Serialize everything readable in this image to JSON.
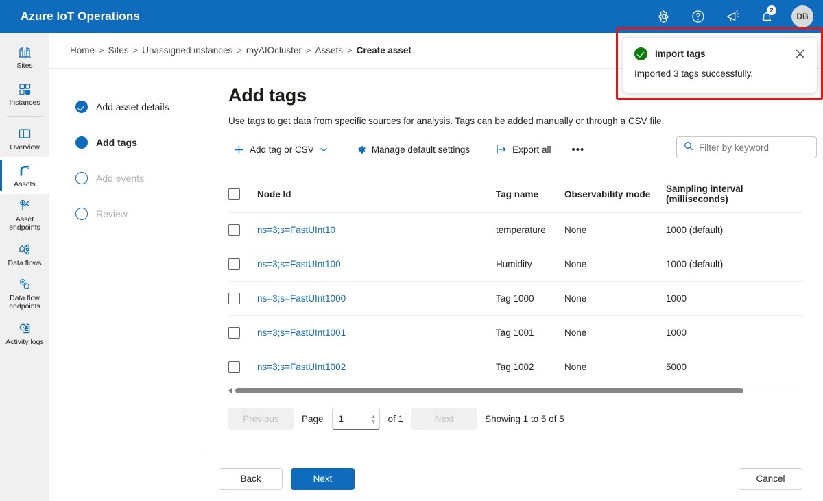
{
  "header": {
    "title": "Azure IoT Operations",
    "icons": [
      {
        "name": "gear-icon",
        "label": "Settings"
      },
      {
        "name": "help-icon",
        "label": "Help"
      },
      {
        "name": "megaphone-icon",
        "label": "Announcements"
      },
      {
        "name": "bell-icon",
        "label": "Notifications",
        "badge": "2"
      }
    ],
    "avatar": "DB",
    "brand_color": "#0f6cbd"
  },
  "sidebar": {
    "items": [
      {
        "label": "Sites",
        "icon": "sites-icon",
        "selected": false
      },
      {
        "label": "Instances",
        "icon": "instances-icon",
        "selected": false
      },
      {
        "label": "Overview",
        "icon": "overview-icon",
        "selected": false
      },
      {
        "label": "Assets",
        "icon": "assets-icon",
        "selected": true
      },
      {
        "label": "Asset endpoints",
        "icon": "asset-endpoints-icon",
        "selected": false
      },
      {
        "label": "Data flows",
        "icon": "data-flows-icon",
        "selected": false
      },
      {
        "label": "Data flow endpoints",
        "icon": "data-flow-endpoints-icon",
        "selected": false
      },
      {
        "label": "Activity logs",
        "icon": "activity-logs-icon",
        "selected": false
      }
    ]
  },
  "breadcrumb": {
    "separator": ">",
    "items": [
      {
        "label": "Home",
        "current": false
      },
      {
        "label": "Sites",
        "current": false
      },
      {
        "label": "Unassigned instances",
        "current": false
      },
      {
        "label": "myAIOcluster",
        "current": false
      },
      {
        "label": "Assets",
        "current": false
      },
      {
        "label": "Create asset",
        "current": true
      }
    ]
  },
  "wizard": {
    "steps": [
      {
        "label": "Add asset details",
        "state": "done"
      },
      {
        "label": "Add tags",
        "state": "active"
      },
      {
        "label": "Add events",
        "state": "todo"
      },
      {
        "label": "Review",
        "state": "todo"
      }
    ]
  },
  "main": {
    "title": "Add tags",
    "description": "Use tags to get data from specific sources for analysis. Tags can be added manually or through a CSV file.",
    "toolbar": {
      "add_tag_label": "Add tag or CSV",
      "add_tag_chevron": "⌄",
      "manage_defaults_label": "Manage default settings",
      "export_all_label": "Export all",
      "overflow_label": "•••"
    },
    "search": {
      "placeholder": "Filter by keyword",
      "value": ""
    },
    "table": {
      "columns": [
        "Node Id",
        "Tag name",
        "Observability mode",
        "Sampling interval (milliseconds)"
      ],
      "rows": [
        {
          "node_id": "ns=3;s=FastUInt10",
          "tag_name": "temperature",
          "observability": "None",
          "sampling": "1000 (default)"
        },
        {
          "node_id": "ns=3;s=FastUInt100",
          "tag_name": "Humidity",
          "observability": "None",
          "sampling": "1000 (default)"
        },
        {
          "node_id": "ns=3;s=FastUInt1000",
          "tag_name": "Tag 1000",
          "observability": "None",
          "sampling": "1000"
        },
        {
          "node_id": "ns=3;s=FastUInt1001",
          "tag_name": "Tag 1001",
          "observability": "None",
          "sampling": "1000"
        },
        {
          "node_id": "ns=3;s=FastUInt1002",
          "tag_name": "Tag 1002",
          "observability": "None",
          "sampling": "5000"
        }
      ]
    },
    "pagination": {
      "previous_label": "Previous",
      "page_label": "Page",
      "page_value": "1",
      "of_label": "of 1",
      "next_label": "Next",
      "showing_label": "Showing 1 to 5 of 5"
    }
  },
  "footer": {
    "back_label": "Back",
    "next_label": "Next",
    "cancel_label": "Cancel"
  },
  "toast": {
    "title": "Import tags",
    "message": "Imported 3 tags successfully.",
    "status": "success",
    "status_color": "#0e7a0b",
    "highlight_color": "#ee1111"
  }
}
